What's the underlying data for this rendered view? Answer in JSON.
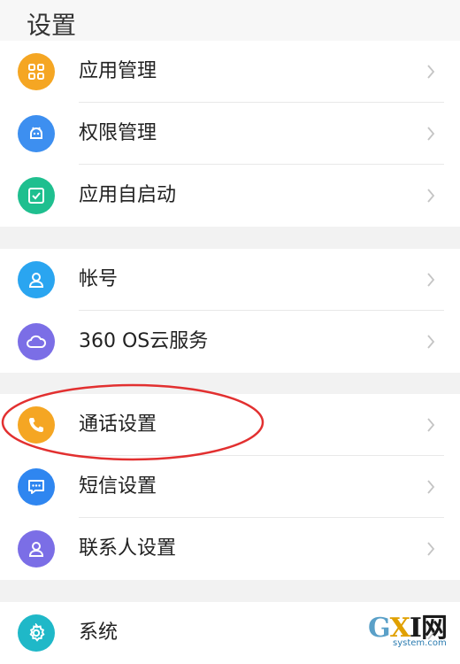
{
  "header": {
    "title": "设置"
  },
  "groups": [
    {
      "items": [
        {
          "label": "应用管理",
          "icon": "apps-grid-icon",
          "color": "#f5a623"
        },
        {
          "label": "权限管理",
          "icon": "android-robot-icon",
          "color": "#3d8ff0"
        },
        {
          "label": "应用自启动",
          "icon": "checkbox-icon",
          "color": "#1fbf8f"
        }
      ]
    },
    {
      "items": [
        {
          "label": "帐号",
          "icon": "user-icon",
          "color": "#2aa5f0"
        },
        {
          "label": "360 OS云服务",
          "icon": "cloud-icon",
          "color": "#7b6ee6"
        }
      ]
    },
    {
      "items": [
        {
          "label": "通话设置",
          "icon": "phone-icon",
          "color": "#f5a623"
        },
        {
          "label": "短信设置",
          "icon": "message-icon",
          "color": "#2f86f0"
        },
        {
          "label": "联系人设置",
          "icon": "contact-icon",
          "color": "#7b6ee6"
        }
      ]
    },
    {
      "items": [
        {
          "label": "系统",
          "icon": "gear-icon",
          "color": "#1fb8c8"
        }
      ]
    }
  ],
  "annotation": {
    "color": "#e23030"
  },
  "watermark": {
    "main_g": "G",
    "main_x": "X",
    "main_rest": "I网",
    "sub": "system.com"
  }
}
